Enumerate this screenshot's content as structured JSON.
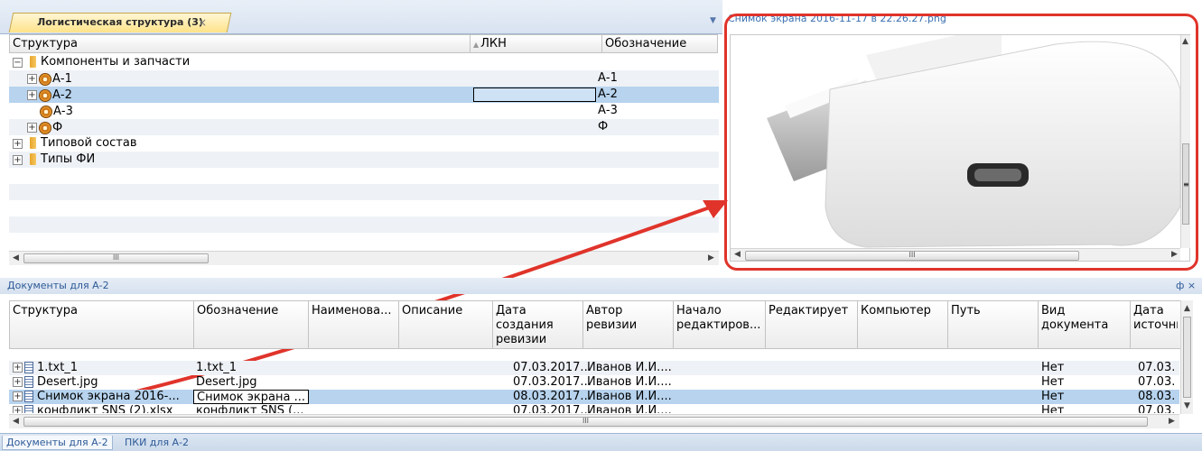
{
  "top_tab": {
    "label": "Логистическая структура (3)",
    "close": "×"
  },
  "tree": {
    "headers": [
      "Структура",
      "ЛКН",
      "Обозначение"
    ],
    "rows": [
      {
        "label": "Компоненты и запчасти",
        "designation": ""
      },
      {
        "label": "А-1",
        "designation": "А-1"
      },
      {
        "label": "А-2",
        "designation": "А-2"
      },
      {
        "label": "А-3",
        "designation": "А-3"
      },
      {
        "label": "Ф",
        "designation": "Ф"
      },
      {
        "label": "Типовой состав",
        "designation": ""
      },
      {
        "label": "Типы ФИ",
        "designation": ""
      }
    ],
    "scroll_grip": "III"
  },
  "preview": {
    "title": "Снимок экрана 2016-11-17 в 22.26.27.png",
    "scroll_grip": "III",
    "vscroll_grip": "≡"
  },
  "documents_panel": {
    "title": "Документы для А-2",
    "pin": "ф ×",
    "headers": [
      "Структура",
      "Обозначение",
      "Наименова...",
      "Описание",
      "Дата создания ревизии",
      "Автор ревизии",
      "Начало редактиров...",
      "Редактирует",
      "Компьютер",
      "Путь",
      "Вид документа",
      "Дата источни"
    ],
    "rows": [
      {
        "structure": "1.txt_1",
        "designation": "1.txt_1",
        "date": "07.03.2017...",
        "author": "Иванов И.И....",
        "doc_type": "Нет",
        "src_date": "07.03."
      },
      {
        "structure": "Desert.jpg",
        "designation": "Desert.jpg",
        "date": "07.03.2017...",
        "author": "Иванов И.И....",
        "doc_type": "Нет",
        "src_date": "07.03."
      },
      {
        "structure": "Снимок экрана 2016-...",
        "designation": "Снимок экрана ...",
        "date": "08.03.2017...",
        "author": "Иванов И.И....",
        "doc_type": "Нет",
        "src_date": "08.03."
      },
      {
        "structure": "конфликт SNS (2).xlsx",
        "designation": "конфликт SNS (...",
        "date": "07.03.2017...",
        "author": "Иванов И.И....",
        "doc_type": "Нет",
        "src_date": "07.03."
      }
    ],
    "scroll_grip": "III"
  },
  "bottom_tabs": [
    "Документы для А-2",
    "ПКИ для А-2"
  ],
  "colors": {
    "selection": "#b7d3ee",
    "annotation_red": "#e0342b",
    "accent_tab": "#ffe38a"
  }
}
